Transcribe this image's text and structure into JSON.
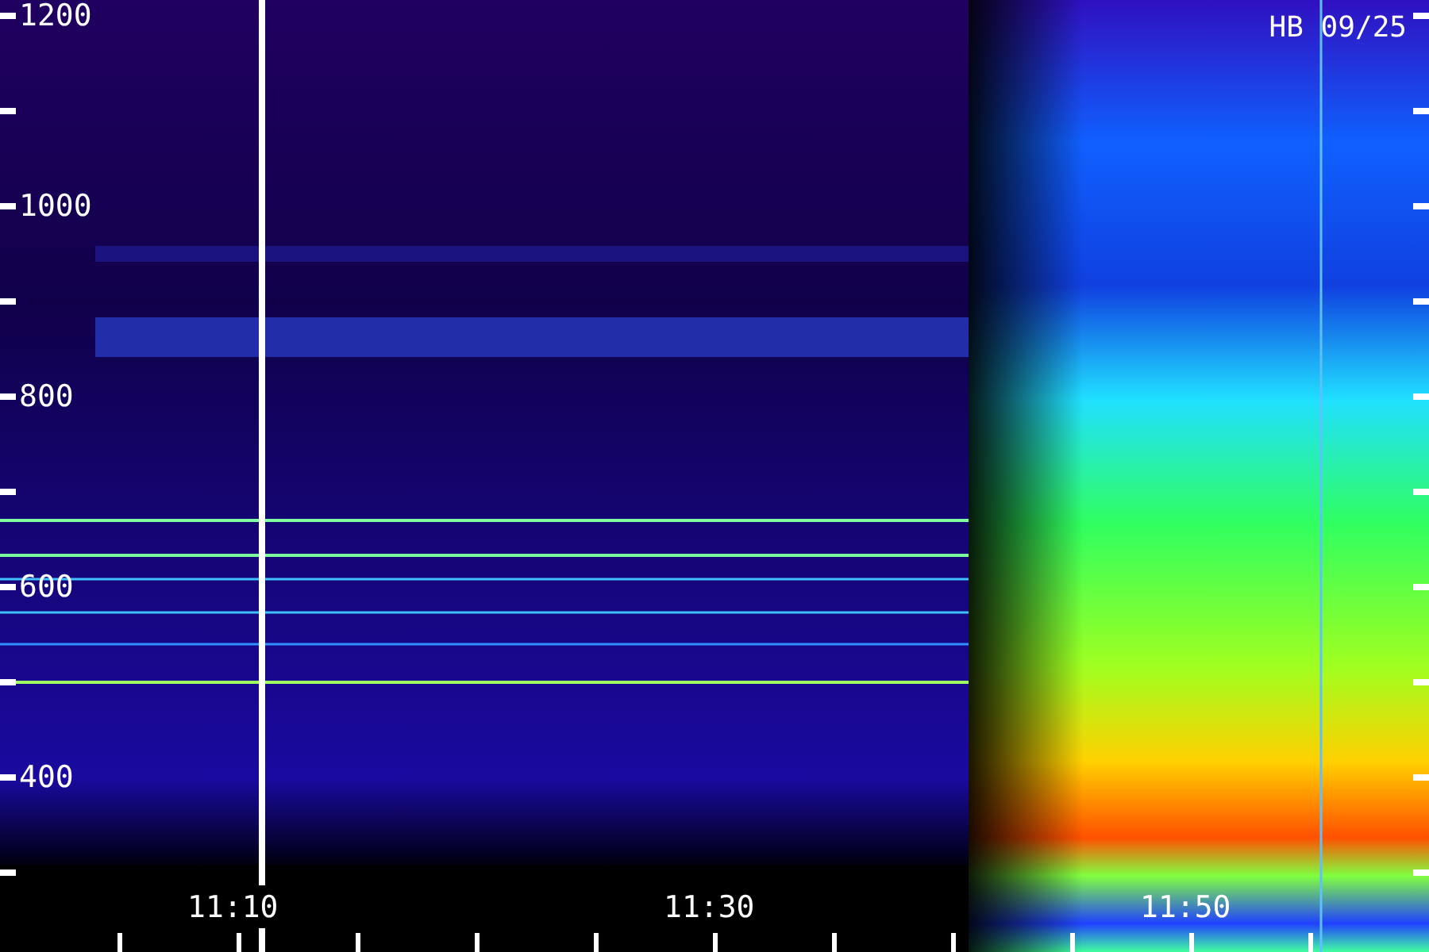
{
  "title": "HB 09/25",
  "y_axis": {
    "labels": [
      "1200",
      "1000",
      "800",
      "600",
      "400"
    ]
  },
  "x_axis": {
    "labels": [
      "11:10",
      "11:30",
      "11:50"
    ]
  }
}
